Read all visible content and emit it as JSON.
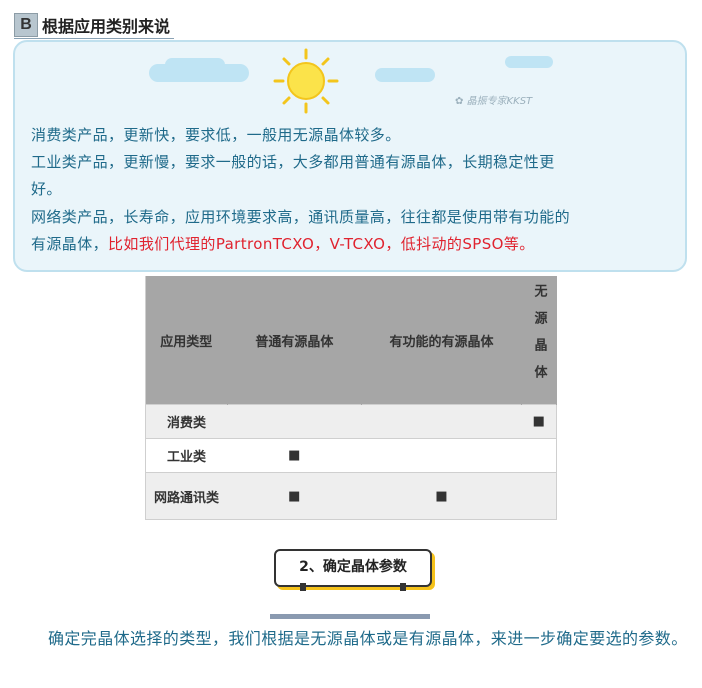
{
  "section": {
    "letter": "B",
    "title": "根据应用类别来说"
  },
  "sky_card": {
    "watermark": "晶振专家KKST",
    "lines": [
      "消费类产品，更新快，要求低，一般用无源晶体较多。",
      "工业类产品，更新慢，要求一般的话，大多都用普通有源晶体，长期稳定性更",
      "好。",
      "网络类产品，长寿命，应用环境要求高，通讯质量高，往往都是使用带有功能的"
    ],
    "last_line_start": "有源晶体，",
    "last_line_red": "比如我们代理的PartronTCXO，V-TCXO，低抖动的SPSO等。"
  },
  "table": {
    "headers": [
      "应用类型",
      "普通有源晶体",
      "有功能的有源晶体",
      "无源晶体"
    ],
    "rows": [
      {
        "type": "消费类",
        "cells": [
          "",
          "",
          "■"
        ]
      },
      {
        "type": "工业类",
        "cells": [
          "■",
          "",
          ""
        ]
      },
      {
        "type": "网路通讯类",
        "cells": [
          "■",
          "■",
          ""
        ]
      }
    ]
  },
  "step": {
    "label": "2、确定晶体参数"
  },
  "body": {
    "text": "确定完晶体选择的类型，我们根据是无源晶体或是有源晶体，来进一步确定要选的参数。"
  },
  "colors": {
    "text_blue": "#1f6a8a",
    "accent_red": "#e0232f",
    "badge_shadow": "#f5c21b"
  }
}
